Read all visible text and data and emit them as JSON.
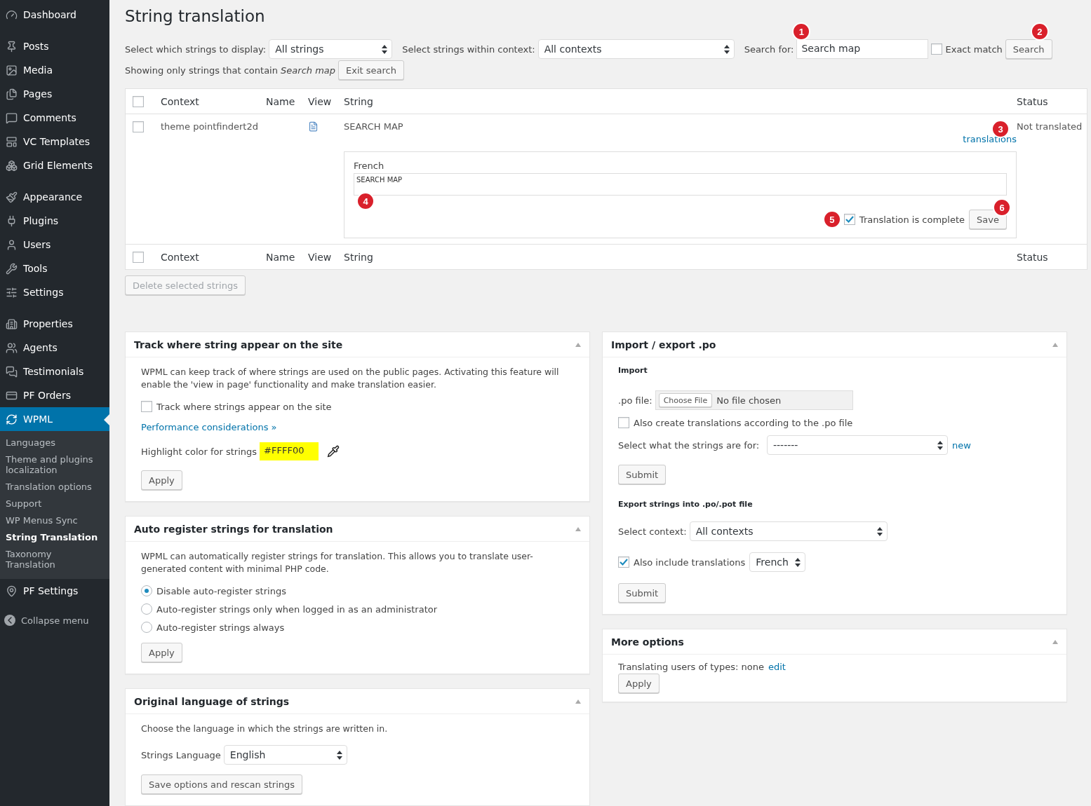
{
  "sidebar": {
    "groups": [
      [
        {
          "label": "Dashboard",
          "selected": false
        }
      ],
      [
        {
          "label": "Posts",
          "selected": false
        },
        {
          "label": "Media",
          "selected": false
        },
        {
          "label": "Pages",
          "selected": false
        },
        {
          "label": "Comments",
          "selected": false
        },
        {
          "label": "VC Templates",
          "selected": false
        },
        {
          "label": "Grid Elements",
          "selected": false
        }
      ],
      [
        {
          "label": "Appearance",
          "selected": false
        },
        {
          "label": "Plugins",
          "selected": false
        },
        {
          "label": "Users",
          "selected": false
        },
        {
          "label": "Tools",
          "selected": false
        },
        {
          "label": "Settings",
          "selected": false
        }
      ],
      [
        {
          "label": "Properties",
          "selected": false
        },
        {
          "label": "Agents",
          "selected": false
        },
        {
          "label": "Testimonials",
          "selected": false
        },
        {
          "label": "PF Orders",
          "selected": false
        },
        {
          "label": "WPML",
          "selected": true,
          "children": [
            {
              "label": "Languages",
              "selected": false
            },
            {
              "label": "Theme and plugins localization",
              "selected": false
            },
            {
              "label": "Translation options",
              "selected": false
            },
            {
              "label": "Support",
              "selected": false
            },
            {
              "label": "WP Menus Sync",
              "selected": false
            },
            {
              "label": "String Translation",
              "selected": true
            },
            {
              "label": "Taxonomy Translation",
              "selected": false
            }
          ]
        },
        {
          "label": "PF Settings",
          "selected": false
        }
      ]
    ],
    "collapse": "Collapse menu"
  },
  "title": "String translation",
  "filters": {
    "display_label": "Select which strings to display:",
    "display_value": "All strings",
    "context_label": "Select strings within context:",
    "context_value": "All contexts",
    "search_label": "Search for:",
    "search_value": "Search map",
    "search_callout": "1",
    "exact_label": "Exact match",
    "exact_checked": false,
    "search_button": "Search",
    "button_callout": "2",
    "showing": "Showing only strings that contain *Search map*",
    "exit_button": "Exit search"
  },
  "table": {
    "columns": [
      "Context",
      "Name",
      "View",
      "String",
      "Status"
    ],
    "rows": [
      {
        "checked": false,
        "context": "theme pointfindert2d",
        "string": "SEARCH MAP",
        "translations_link": "translations",
        "status_callout": "3",
        "status": "Not translated",
        "editor": {
          "language": "French",
          "value": "SEARCH MAP",
          "value_callout": "4",
          "complete_callout": "5",
          "complete": true,
          "complete_label": "Translation is complete",
          "save": "Save",
          "save_callout": "6"
        }
      }
    ],
    "footer_columns": [
      "Context",
      "Name",
      "View",
      "String",
      "Status"
    ],
    "header_checked": false,
    "footer_checked": false,
    "delete_button": "Delete selected strings",
    "delete_disabled": true
  },
  "track": {
    "title": "Track where string appear on the site",
    "text": "WPML can keep track of where strings are used on the public pages. Activating this feature will enable the 'view in page' functionality and make translation easier.",
    "checkbox_label": "Track where strings appear on the site",
    "checked": false,
    "link": "Performance considerations »",
    "color_label": "Highlight color for strings",
    "color_value": "#FFFF00",
    "color": "#ffff00",
    "apply": "Apply"
  },
  "auto_register": {
    "title": "Auto register strings for translation",
    "text": "WPML can automatically register strings for translation. This allows you to translate user-generated content with minimal PHP code.",
    "options": [
      {
        "label": "Disable auto-register strings",
        "selected": true
      },
      {
        "label": "Auto-register strings only when logged in as an administrator",
        "selected": false
      },
      {
        "label": "Auto-register strings always",
        "selected": false
      }
    ],
    "apply": "Apply"
  },
  "original_language": {
    "title": "Original language of strings",
    "text": "Choose the language in which the strings are written in.",
    "label": "Strings Language",
    "value": "English",
    "button": "Save options and rescan strings"
  },
  "import_export": {
    "title": "Import / export .po",
    "import_heading": "Import",
    "file_label": ".po file:",
    "choose_button": "Choose File",
    "file_status": "No file chosen",
    "also_create_label": "Also create translations according to the .po file",
    "also_create_checked": false,
    "strings_for_label": "Select what the strings are for:",
    "strings_for_value": "-------",
    "new_link": "new",
    "submit": "Submit",
    "export_heading": "Export strings into .po/.pot file",
    "context_label": "Select context:",
    "context_value": "All contexts",
    "include_label": "Also include translations",
    "include_checked": true,
    "include_language": "French",
    "submit_export": "Submit"
  },
  "more_options": {
    "title": "More options",
    "text": "Translating users of types: none",
    "edit_link": "edit",
    "apply": "Apply"
  }
}
